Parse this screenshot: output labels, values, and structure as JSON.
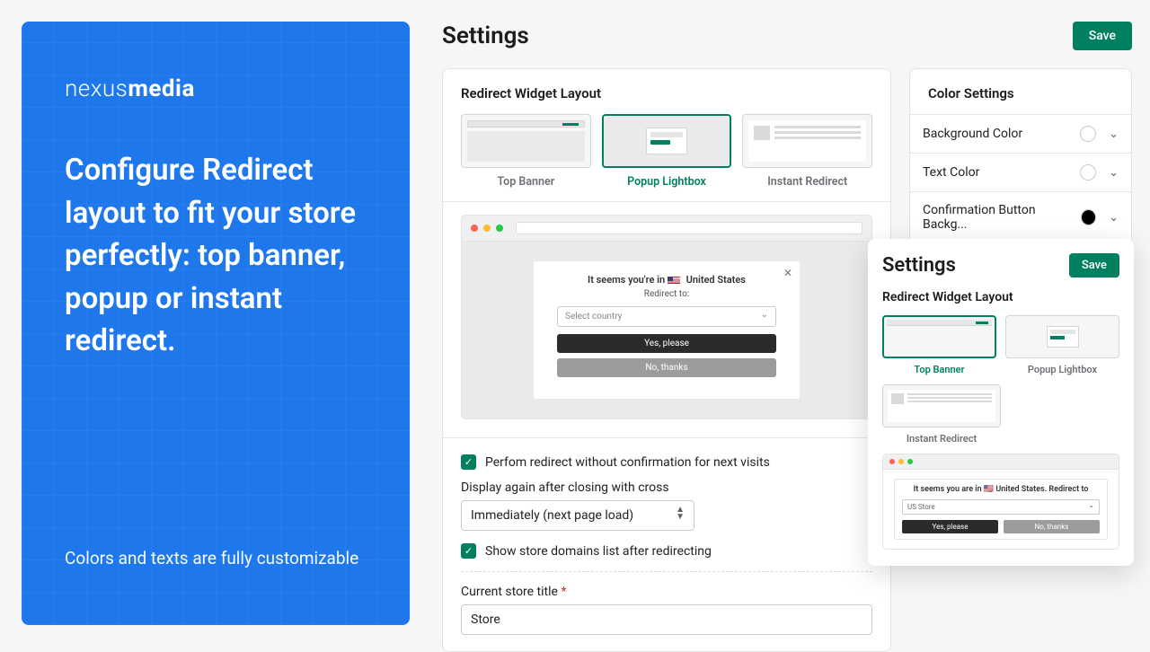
{
  "hero": {
    "brand_light": "nexus",
    "brand_bold": "media",
    "headline": "Configure Redirect layout to fit your store perfectly: top banner, popup or instant redirect.",
    "subline": "Colors and texts are fully customizable"
  },
  "page": {
    "title": "Settings",
    "save_label": "Save"
  },
  "layout": {
    "section_title": "Redirect Widget Layout",
    "options": [
      "Top Banner",
      "Popup Lightbox",
      "Instant Redirect"
    ],
    "selected_index": 1
  },
  "dialog": {
    "line1_prefix": "It seems you're in",
    "line1_country": "United States",
    "sub": "Redirect to:",
    "select_placeholder": "Select country",
    "yes": "Yes, please",
    "no": "No, thanks"
  },
  "options": {
    "chk_confirm": "Perfom redirect without confirmation for next visits",
    "display_again_label": "Display again after closing with cross",
    "display_again_value": "Immediately (next page load)",
    "chk_domains": "Show store domains list after redirecting",
    "title_label": "Current store title",
    "title_value": "Store"
  },
  "colors": {
    "section_title": "Color Settings",
    "rows": [
      "Background Color",
      "Text Color",
      "Confirmation Button Backg..."
    ]
  },
  "float": {
    "title": "Settings",
    "save": "Save",
    "section": "Redirect Widget Layout",
    "labels": [
      "Top Banner",
      "Popup Lightbox",
      "Instant Redirect"
    ],
    "banner_text": "It seems you are in 🇺🇸 United States. Redirect to",
    "banner_sel": "US Store",
    "yes": "Yes, please",
    "no": "No, thanks"
  }
}
